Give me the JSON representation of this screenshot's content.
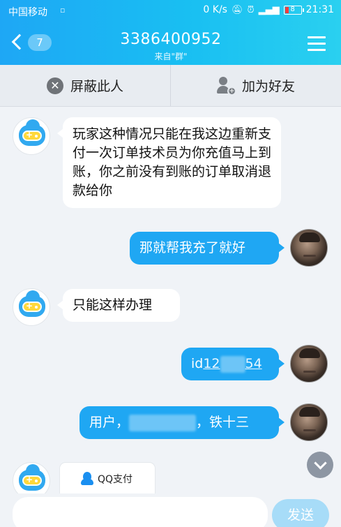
{
  "status_bar": {
    "carrier": "中国移动",
    "sim_icon": "sim-card-icon",
    "speed": "0 K/s",
    "icons": [
      "mute-icon",
      "alarm-icon",
      "4g-signal-icon"
    ],
    "battery_level": "8",
    "time": "21:31"
  },
  "header": {
    "unread_count": "7",
    "title": "3386400952",
    "subtitle": "来自\"群\"",
    "back_icon": "back-chevron-icon",
    "menu_icon": "hamburger-menu-icon"
  },
  "actions": {
    "block_label": "屏蔽此人",
    "block_icon": "block-icon",
    "add_label": "加为好友",
    "add_icon": "add-friend-icon"
  },
  "messages": [
    {
      "side": "left",
      "text": "玩家这种情况只能在我这边重新支付一次订单技术员为你充值马上到账，你之前没有到账的订单取消退款给你"
    },
    {
      "side": "right",
      "text": "那就帮我充了就好"
    },
    {
      "side": "left",
      "text": "只能这样办理"
    },
    {
      "side": "right",
      "text_prefix": "id",
      "link_start": "12",
      "link_end": "54"
    },
    {
      "side": "right",
      "text_prefix": "用户，",
      "text_suffix": "，铁十三"
    }
  ],
  "pay_card": {
    "icon": "qq-penguin-icon",
    "label": "QQ支付"
  },
  "composer": {
    "placeholder": "",
    "send_label": "发送"
  },
  "colors": {
    "header_blue": "#1ea7f5",
    "bubble_blue": "#1fa7f3",
    "send_disabled": "#a7dcf8",
    "background": "#f0f3f7"
  }
}
